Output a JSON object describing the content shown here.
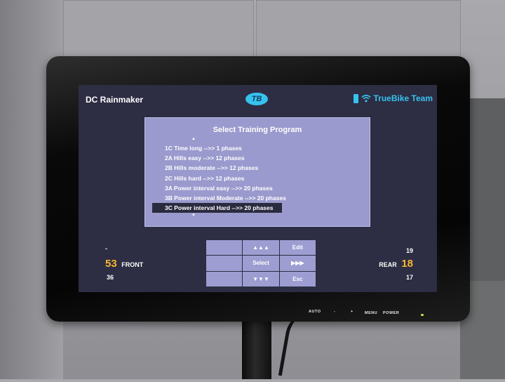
{
  "header": {
    "user": "DC Rainmaker",
    "logo": "TB",
    "brand": "TrueBike Team",
    "icons": [
      "battery-icon",
      "wifi-icon"
    ]
  },
  "dialog": {
    "title": "Select Training Program",
    "programs": [
      "1C Time long -->> 1 phases",
      "2A Hills easy -->> 12 phases",
      "2B Hills moderate -->> 12 phases",
      "2C Hills hard -->> 12 phases",
      "3A Power interval easy -->> 20 phases",
      "3B Power interval Moderate -->> 20 phases",
      "3C Power interval Hard -->> 20 phases"
    ],
    "selected_index": 6
  },
  "front": {
    "label": "FRONT",
    "up": "-",
    "current": "53",
    "down": "36"
  },
  "rear": {
    "label": "REAR",
    "up": "19",
    "current": "18",
    "down": "17"
  },
  "keypad": {
    "up": "▲▲▲",
    "edit": "Edit",
    "select": "Select",
    "right": "▶▶▶",
    "down": "▼▼▼",
    "esc": "Esc"
  },
  "monitor_buttons": {
    "auto": "AUTO",
    "minus": "-",
    "plus": "+",
    "menu": "MENU",
    "power": "POWER"
  },
  "colors": {
    "screen_bg": "#2d2d43",
    "dialog_bg": "#9a9ace",
    "accent": "#35c3ef",
    "gear": "#f5b730"
  }
}
